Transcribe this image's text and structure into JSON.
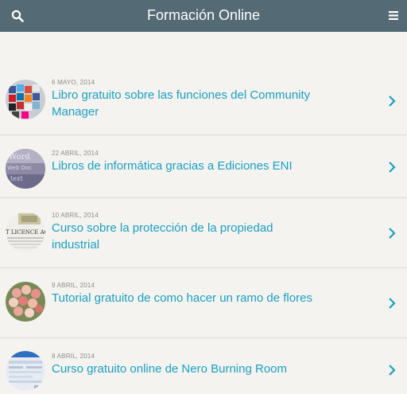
{
  "header": {
    "title": "Formación Online",
    "search_icon": "search-icon",
    "menu_icon": "hamburger-menu-icon"
  },
  "colors": {
    "header_bg": "#546a74",
    "link": "#1aa0c4",
    "background": "#f4f3ef"
  },
  "posts": [
    {
      "date": "6 MAYO, 2014",
      "title": "Libro gratuito sobre las funciones del Community Manager"
    },
    {
      "date": "22 ABRIL, 2014",
      "title": "Libros de informática gracias a Ediciones ENI"
    },
    {
      "date": "10 ABRIL, 2014",
      "title": "Curso sobre la protección de la propiedad industrial"
    },
    {
      "date": "9 ABRIL, 2014",
      "title": "Tutorial gratuito de como hacer un ramo de flores"
    },
    {
      "date": "8 ABRIL, 2014",
      "title": "Curso gratuito online de Nero Burning Room"
    }
  ]
}
